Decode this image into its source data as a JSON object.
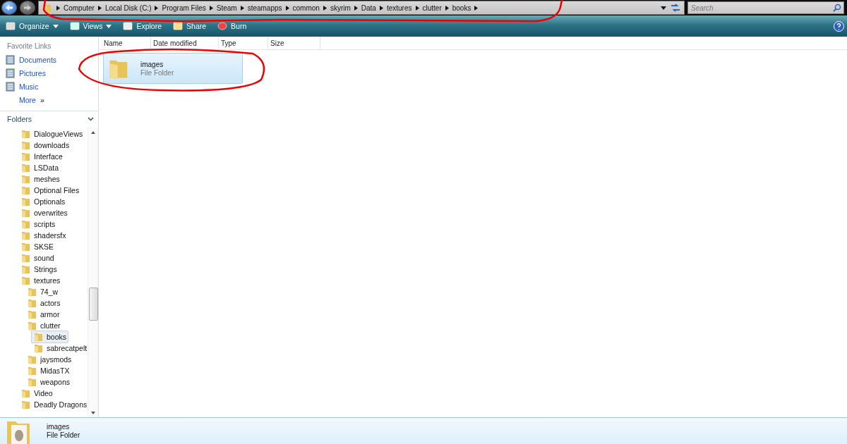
{
  "address_bar": {
    "crumbs": [
      "Computer",
      "Local Disk (C:)",
      "Program Files",
      "Steam",
      "steamapps",
      "common",
      "skyrim",
      "Data",
      "textures",
      "clutter",
      "books"
    ]
  },
  "search": {
    "placeholder": "Search"
  },
  "toolbar": {
    "buttons": [
      {
        "label": "Organize",
        "kind": "menu"
      },
      {
        "label": "Views",
        "kind": "menu"
      },
      {
        "label": "Explore",
        "kind": "plain"
      },
      {
        "label": "Share",
        "kind": "plain"
      },
      {
        "label": "Burn",
        "kind": "plain"
      }
    ]
  },
  "favorite_links": {
    "title": "Favorite Links",
    "items": [
      "Documents",
      "Pictures",
      "Music"
    ],
    "more": "More",
    "more_glyph": "»"
  },
  "folders": {
    "title": "Folders",
    "items": [
      {
        "label": "DialogueViews",
        "selected": false
      },
      {
        "label": "downloads",
        "selected": false
      },
      {
        "label": "Interface",
        "selected": false
      },
      {
        "label": "LSData",
        "selected": false
      },
      {
        "label": "meshes",
        "selected": false
      },
      {
        "label": "Optional Files",
        "selected": false
      },
      {
        "label": "Optionals",
        "selected": false
      },
      {
        "label": "overwrites",
        "selected": false
      },
      {
        "label": "scripts",
        "selected": false
      },
      {
        "label": "shadersfx",
        "selected": false
      },
      {
        "label": "SKSE",
        "selected": false
      },
      {
        "label": "sound",
        "selected": false
      },
      {
        "label": "Strings",
        "selected": false
      },
      {
        "label": "textures",
        "selected": false,
        "children": [
          {
            "label": "74_w",
            "selected": false
          },
          {
            "label": "actors",
            "selected": false
          },
          {
            "label": "armor",
            "selected": false
          },
          {
            "label": "clutter",
            "selected": false,
            "children": [
              {
                "label": "books",
                "selected": true
              },
              {
                "label": "sabrecatpelt",
                "selected": false
              }
            ]
          },
          {
            "label": "jaysmods",
            "selected": false
          },
          {
            "label": "MidasTX",
            "selected": false
          },
          {
            "label": "weapons",
            "selected": false
          }
        ]
      },
      {
        "label": "Video",
        "selected": false
      },
      {
        "label": "Deadly Dragons",
        "selected": false
      }
    ]
  },
  "columns": [
    "Name",
    "Date modified",
    "Type",
    "Size"
  ],
  "files": [
    {
      "name": "images",
      "type": "File Folder",
      "selected": true
    }
  ],
  "details_pane": {
    "name": "images",
    "type": "File Folder"
  }
}
